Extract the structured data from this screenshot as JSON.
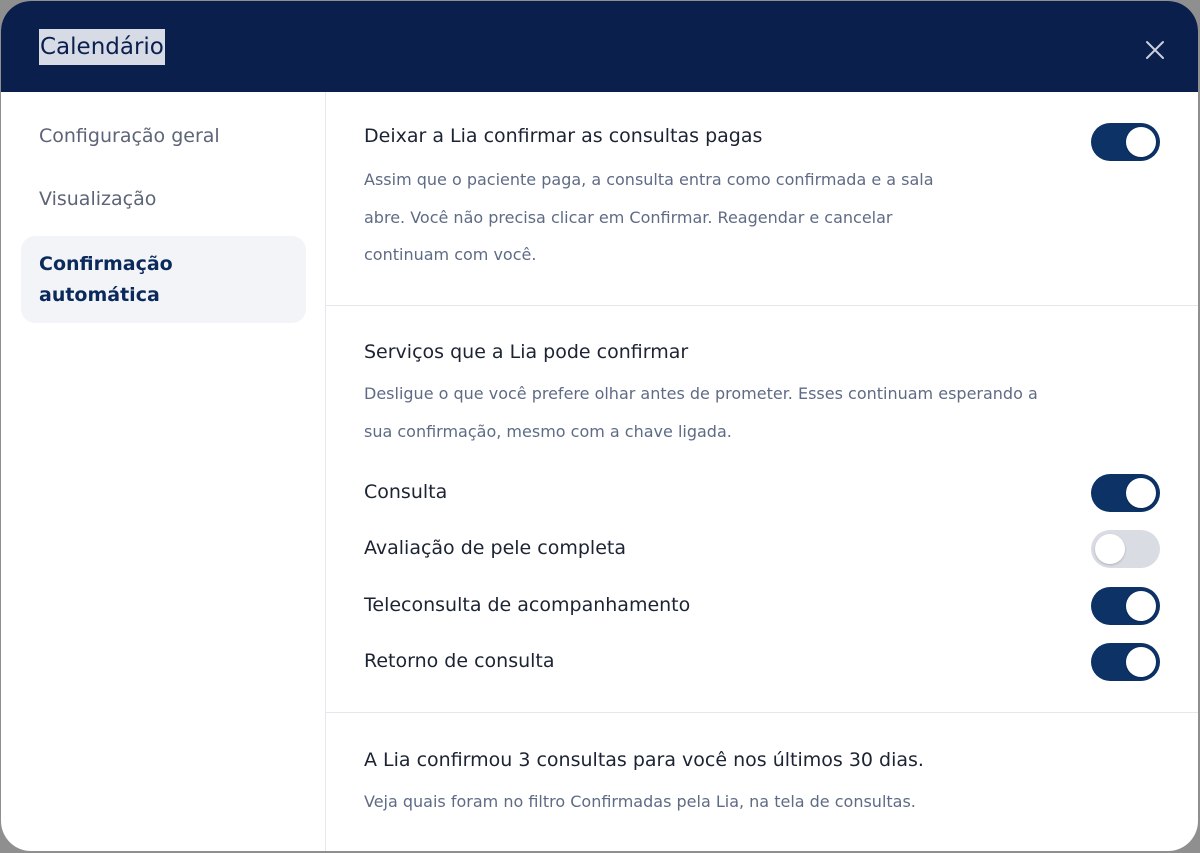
{
  "modal": {
    "title": "Calendário",
    "close_icon": "close-icon"
  },
  "sidebar": {
    "items": [
      {
        "label": "Configuração geral",
        "active": false
      },
      {
        "label": "Visualização",
        "active": false
      },
      {
        "label": "Confirmação automática",
        "active": true
      }
    ]
  },
  "auto_confirm": {
    "heading": "Deixar a Lia confirmar as consultas pagas",
    "description_lines": [
      "Assim que o paciente paga, a consulta entra como confirmada e a sala",
      "abre. Você não precisa clicar em Confirmar. Reagendar e cancelar",
      "continuam com você."
    ],
    "enabled": true
  },
  "services": {
    "heading": "Serviços que a Lia pode confirmar",
    "description_lines": [
      "Desligue o que você prefere olhar antes de prometer. Esses continuam esperando a",
      "sua confirmação, mesmo com a chave ligada."
    ],
    "items": [
      {
        "label": "Consulta",
        "enabled": true
      },
      {
        "label": "Avaliação de pele completa",
        "enabled": false
      },
      {
        "label": "Teleconsulta de acompanhamento",
        "enabled": true
      },
      {
        "label": "Retorno de consulta",
        "enabled": true
      }
    ]
  },
  "summary": {
    "heading": "A Lia confirmou 3 consultas para você nos últimos 30 dias.",
    "description": "Veja quais foram no filtro Confirmadas pela Lia, na tela de consultas."
  },
  "colors": {
    "header_bg": "#0b1f4d",
    "toggle_on": "#0c3266",
    "toggle_off": "#d9dce3",
    "active_item_bg": "#f3f4f8"
  }
}
